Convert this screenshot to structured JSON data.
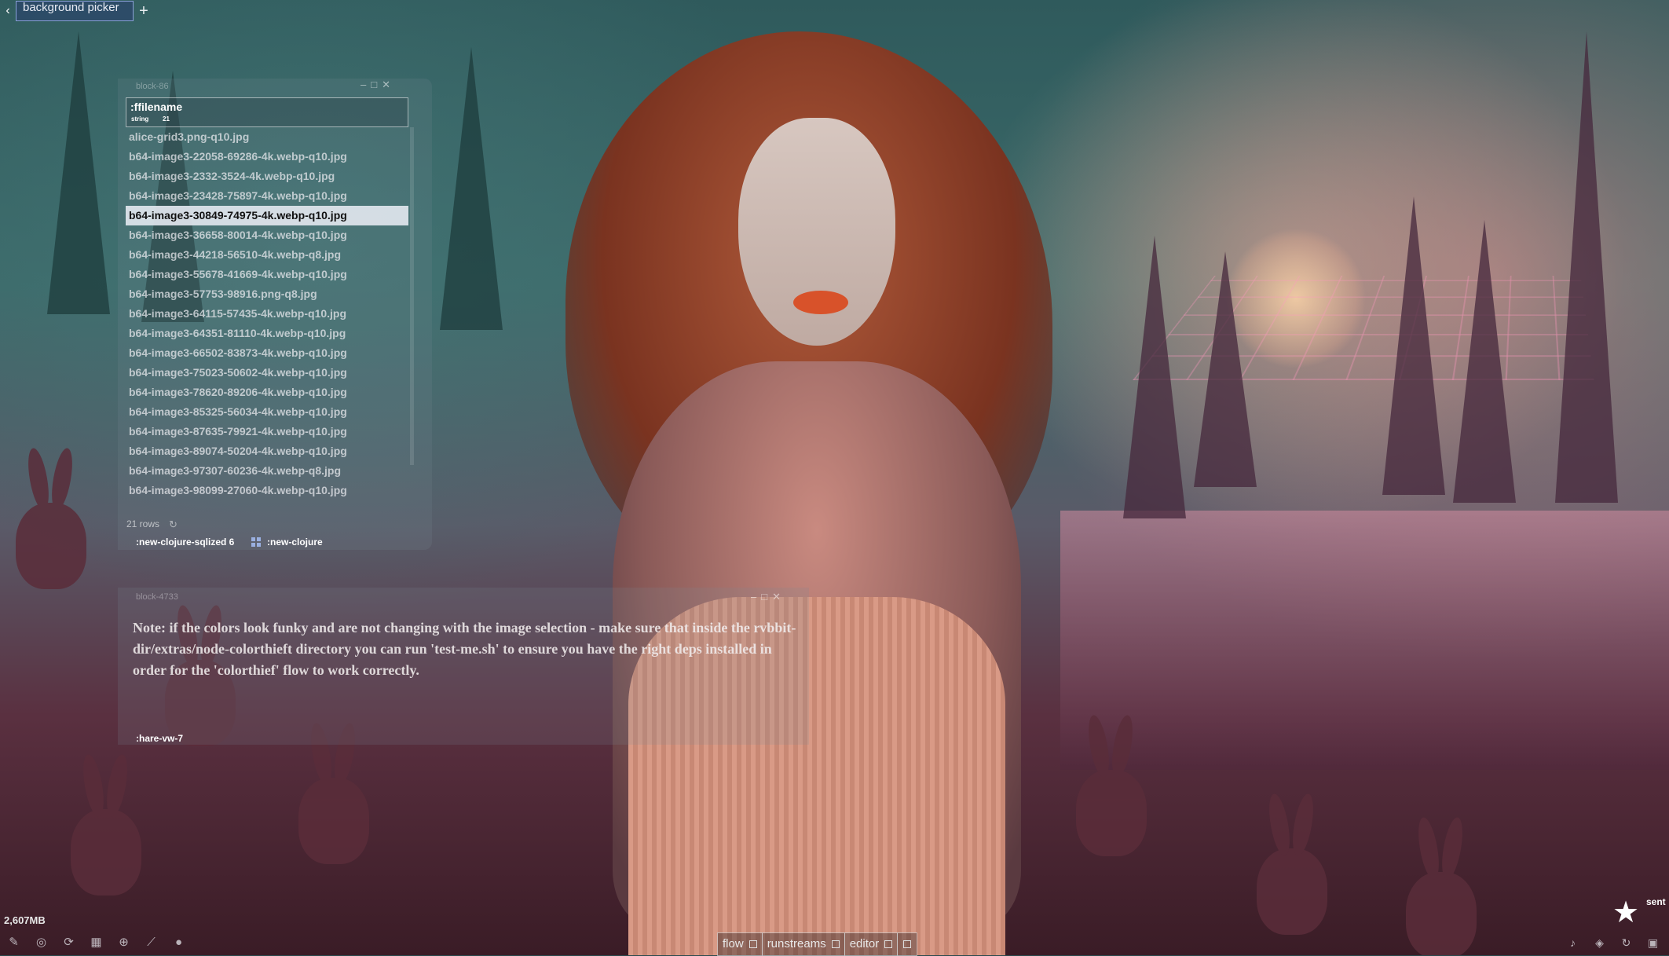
{
  "tabs": {
    "back_glyph": "‹",
    "active": "background picker",
    "add_glyph": "+"
  },
  "list_panel": {
    "title": "block-86",
    "field": {
      "name": ":ffilename",
      "type": "string",
      "count": "21"
    },
    "files": [
      "alice-grid3.png-q10.jpg",
      "b64-image3-22058-69286-4k.webp-q10.jpg",
      "b64-image3-2332-3524-4k.webp-q10.jpg",
      "b64-image3-23428-75897-4k.webp-q10.jpg",
      "b64-image3-30849-74975-4k.webp-q10.jpg",
      "b64-image3-36658-80014-4k.webp-q10.jpg",
      "b64-image3-44218-56510-4k.webp-q8.jpg",
      "b64-image3-55678-41669-4k.webp-q10.jpg",
      "b64-image3-57753-98916.png-q8.jpg",
      "b64-image3-64115-57435-4k.webp-q10.jpg",
      "b64-image3-64351-81110-4k.webp-q10.jpg",
      "b64-image3-66502-83873-4k.webp-q10.jpg",
      "b64-image3-75023-50602-4k.webp-q10.jpg",
      "b64-image3-78620-89206-4k.webp-q10.jpg",
      "b64-image3-85325-56034-4k.webp-q10.jpg",
      "b64-image3-87635-79921-4k.webp-q10.jpg",
      "b64-image3-89074-50204-4k.webp-q10.jpg",
      "b64-image3-97307-60236-4k.webp-q8.jpg",
      "b64-image3-98099-27060-4k.webp-q10.jpg"
    ],
    "selected_index": 4,
    "rows_label": "21 rows",
    "ref_a": ":new-clojure-sqlized 6",
    "ref_b": ":new-clojure"
  },
  "note_panel": {
    "title": "block-4733",
    "text": "Note: if the colors look funky and are not changing with the image selection - make sure that inside the rvbbit-dir/extras/node-colorthieft directory you can run 'test-me.sh' to ensure you have the right deps installed in order for the 'colorthief' flow to work correctly.",
    "ref": ":hare-vw-7"
  },
  "status": {
    "memory": "2,607MB",
    "left_icons": [
      "pen-off-icon",
      "eye-off-icon",
      "refresh-icon",
      "table-icon",
      "globe-icon",
      "signal-icon",
      "microphone-icon"
    ],
    "modes": [
      "flow",
      "runstreams",
      "editor"
    ],
    "right_icons": [
      "bell-icon",
      "layers-icon",
      "sync-icon",
      "save-icon"
    ],
    "sent_label": "sent"
  },
  "colors": {
    "selection": "#e1e6ee",
    "grid_icon": "#9ab0e0"
  }
}
